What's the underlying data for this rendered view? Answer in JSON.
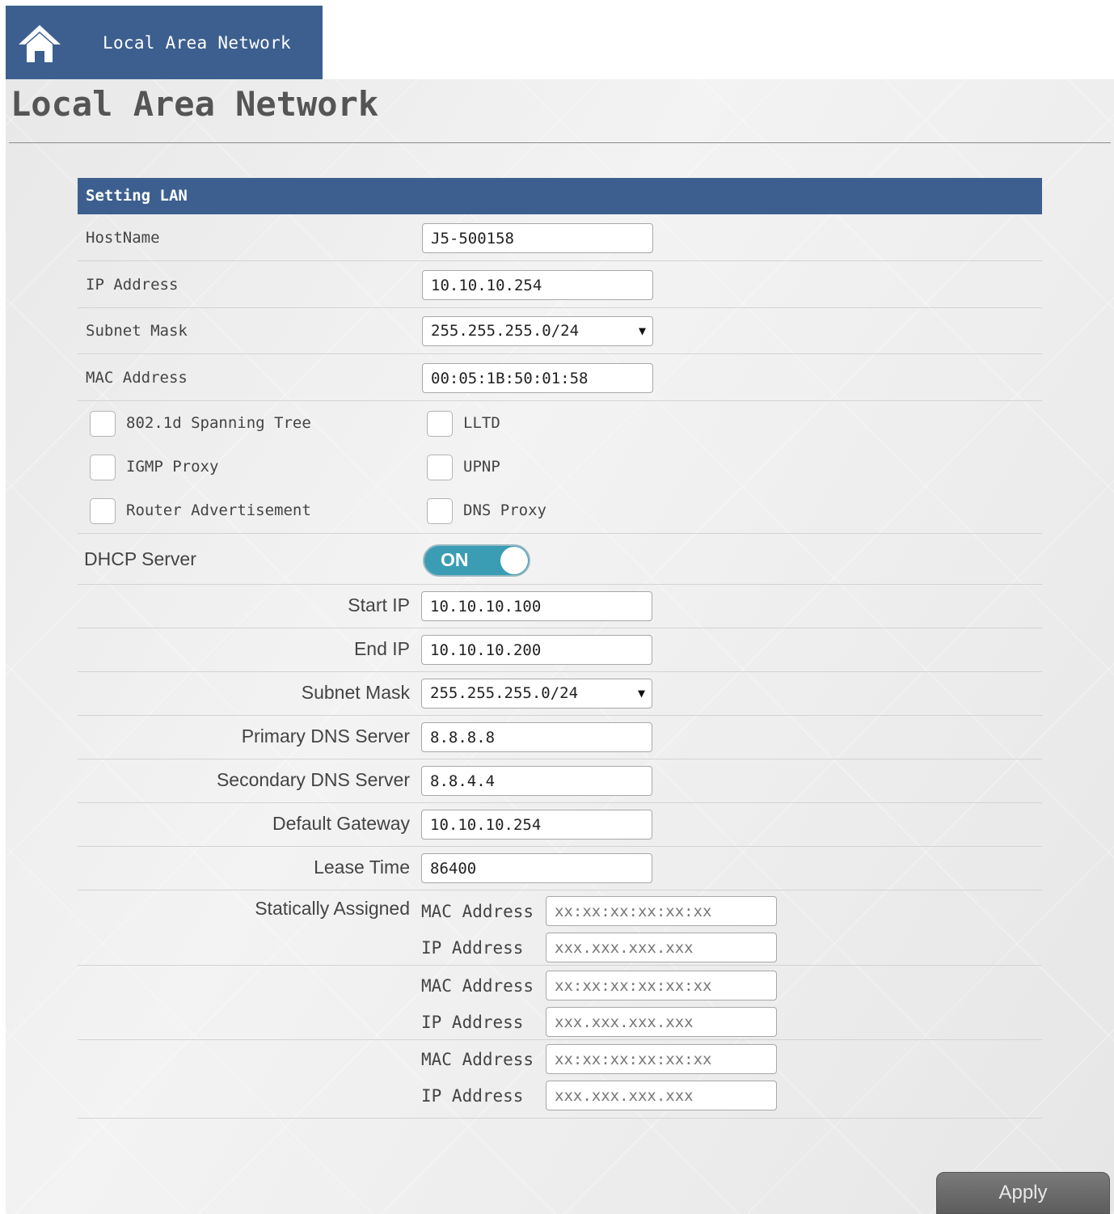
{
  "topbar": {
    "icon": "home-icon",
    "breadcrumb": "Local Area Network",
    "color": "#3c5f8f"
  },
  "page_title": "Local Area Network",
  "section_header": "Setting LAN",
  "lan": {
    "hostname_label": "HostName",
    "hostname_value": "J5-500158",
    "ip_label": "IP Address",
    "ip_value": "10.10.10.254",
    "subnet_label": "Subnet Mask",
    "subnet_value": "255.255.255.0/24",
    "mac_label": "MAC Address",
    "mac_value": "00:05:1B:50:01:58"
  },
  "checkboxes": {
    "stp": "802.1d Spanning Tree",
    "lltd": "LLTD",
    "igmp": "IGMP Proxy",
    "upnp": "UPNP",
    "router_adv": "Router Advertisement",
    "dns_proxy": "DNS Proxy"
  },
  "dhcp": {
    "label": "DHCP Server",
    "toggle_text": "ON",
    "toggle_color": "#3a9db3",
    "start_ip_label": "Start IP",
    "start_ip_value": "10.10.10.100",
    "end_ip_label": "End IP",
    "end_ip_value": "10.10.10.200",
    "subnet_label": "Subnet Mask",
    "subnet_value": "255.255.255.0/24",
    "primary_dns_label": "Primary DNS Server",
    "primary_dns_value": "8.8.8.8",
    "secondary_dns_label": "Secondary DNS Server",
    "secondary_dns_value": "8.8.4.4",
    "gateway_label": "Default Gateway",
    "gateway_value": "10.10.10.254",
    "lease_label": "Lease Time",
    "lease_value": "86400",
    "static_label": "Statically Assigned",
    "mac_label": "MAC Address",
    "ip_label": "IP Address",
    "mac_placeholder": "xx:xx:xx:xx:xx:xx",
    "ip_placeholder": "xxx.xxx.xxx.xxx"
  },
  "apply_label": "Apply"
}
